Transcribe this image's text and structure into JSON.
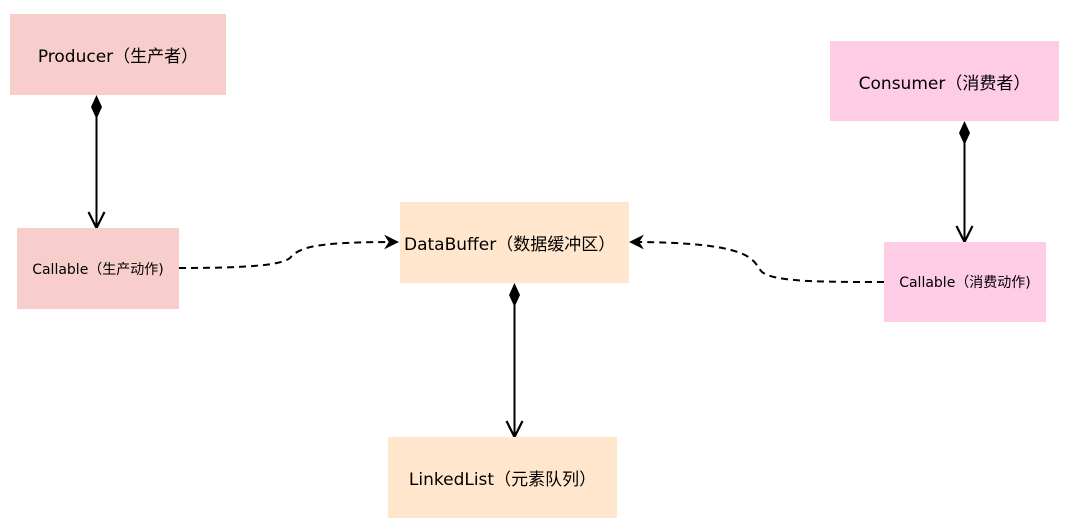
{
  "colors": {
    "producer_fill": "#f8cecc",
    "consumer_fill": "#ffcce6",
    "buffer_fill": "#ffe6cc",
    "edge": "#000000"
  },
  "nodes": {
    "producer": "Producer（生产者）",
    "consumer": "Consumer（消费者）",
    "callable_producer": "Callable（生产动作)",
    "databuffer": "DataBuffer（数据缓冲区）",
    "callable_consumer": "Callable（消费动作)",
    "linkedlist": "LinkedList（元素队列）"
  },
  "edges": [
    {
      "from": "producer",
      "to": "callable_producer",
      "style": "composition"
    },
    {
      "from": "consumer",
      "to": "callable_consumer",
      "style": "composition"
    },
    {
      "from": "databuffer",
      "to": "linkedlist",
      "style": "composition"
    },
    {
      "from": "callable_producer",
      "to": "databuffer",
      "style": "dashed-arrow"
    },
    {
      "from": "callable_consumer",
      "to": "databuffer",
      "style": "dashed-arrow"
    }
  ]
}
